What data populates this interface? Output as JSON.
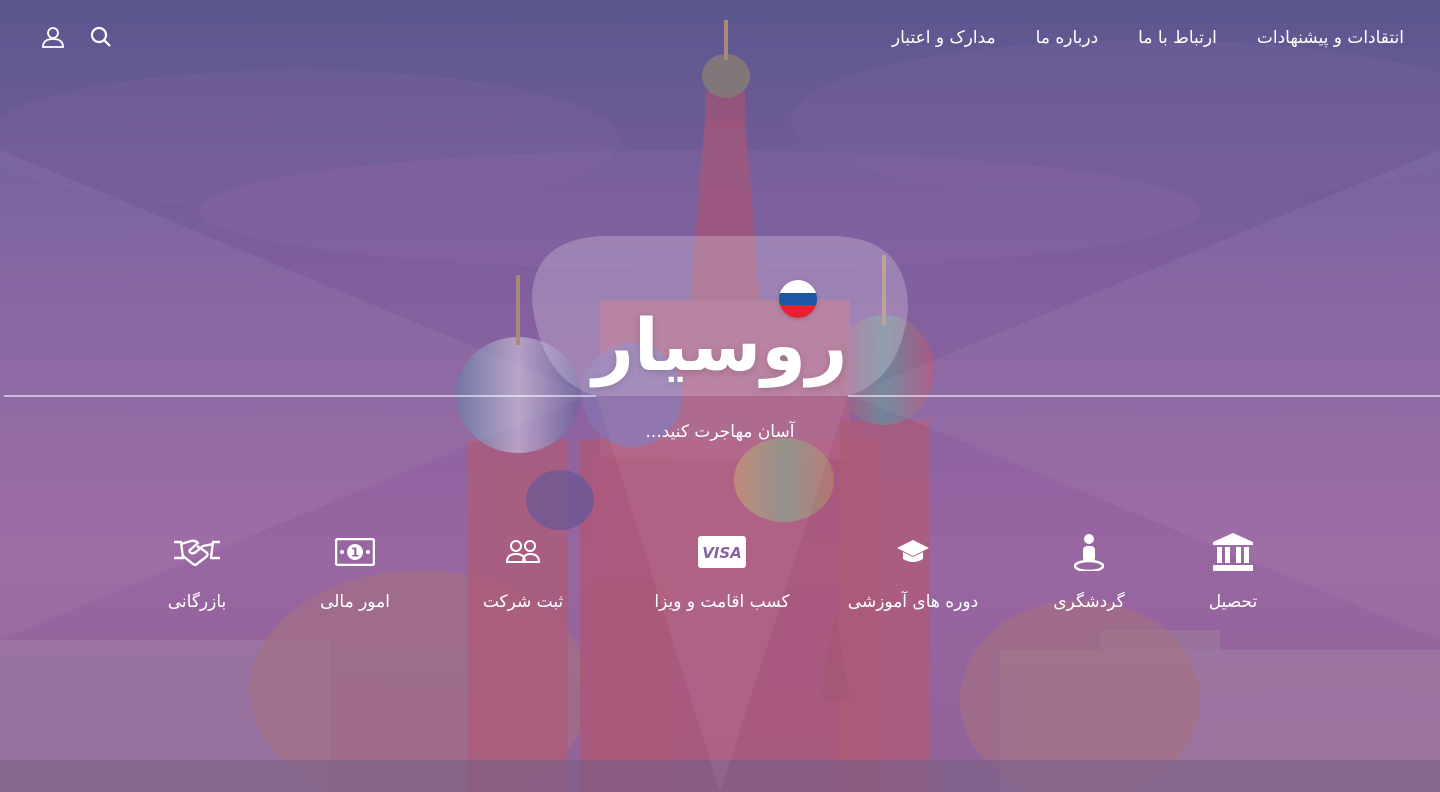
{
  "header": {
    "nav": [
      {
        "label": "انتقادات و پیشنهادات",
        "name": "nav-feedback"
      },
      {
        "label": "ارتباط با ما",
        "name": "nav-contact"
      },
      {
        "label": "درباره ما",
        "name": "nav-about"
      },
      {
        "label": "مدارک و اعتبار",
        "name": "nav-credentials"
      }
    ],
    "icons": [
      "search-icon",
      "user-icon"
    ]
  },
  "hero": {
    "logo_text": "روسیار",
    "tagline": "آسان مهاجرت کنید...",
    "flag_colors": [
      "#ffffff",
      "#1c57a5",
      "#e4222f"
    ]
  },
  "services": [
    {
      "label": "تحصیل",
      "icon": "university-icon"
    },
    {
      "label": "گردشگری",
      "icon": "tourist-icon"
    },
    {
      "label": "دوره های آموزشی",
      "icon": "graduation-cap-icon"
    },
    {
      "label": "کسب اقامت و ویزا",
      "icon": "visa-card-icon",
      "icon_text": "VISA"
    },
    {
      "label": "ثبت شرکت",
      "icon": "users-icon"
    },
    {
      "label": "امور مالی",
      "icon": "money-bill-icon"
    },
    {
      "label": "بازرگانی",
      "icon": "handshake-icon"
    }
  ],
  "colors": {
    "overlay": "#8a62a0",
    "text": "#ffffff"
  }
}
